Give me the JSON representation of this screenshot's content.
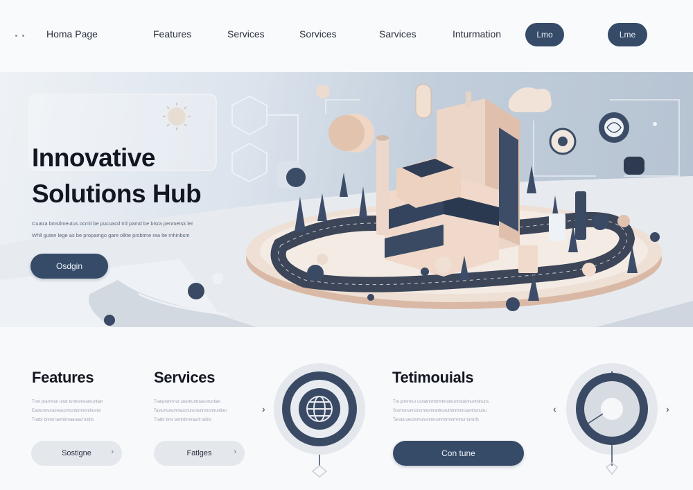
{
  "nav": {
    "links": [
      {
        "label": "Homa Page"
      },
      {
        "label": "Features"
      },
      {
        "label": "Services"
      },
      {
        "label": "Sorvices"
      },
      {
        "label": "Sarvices"
      },
      {
        "label": "Inturmation"
      }
    ],
    "buttons": [
      {
        "label": "Lmo"
      },
      {
        "label": "Lme"
      }
    ]
  },
  "hero": {
    "title_line1": "Innovative",
    "title_line2": "Solutions Hub",
    "text_line1": "Cuatra bmsilmeutus ocmil be pucuacd trd pamd be bisra penmetsk ler",
    "text_line2": "Whll guten lege as be propamgo gare olltte prsbtme rea lte mhinbsm",
    "cta_label": "Osdgin"
  },
  "sections": {
    "features": {
      "title": "Features",
      "lines": [
        "Tron prarrmun unar tuntrorneunruntian",
        "Eastumnuraonsucmruntumnontinunin",
        "Tratbr bnmn tartnbrnaaraad tutiits"
      ],
      "button_label": "Sostigne"
    },
    "services": {
      "title": "Services",
      "lines": [
        "Tranpranrrnur unartruntrauunruntian",
        "Tasturnurumnaucnuruntunnmontruntian",
        "Tratbr bmr tarrtnbrmraurit tutiits"
      ],
      "button_label": "Fatlges"
    },
    "testimonials": {
      "title": "Tetimouials",
      "lines": [
        "Tre prmrrnur ucnatnrmttrmtnrunrunnstuinnuntnlnuns",
        "Srcrtronunnuncmnontrantnurutntnrlnnnuuntnunuiru",
        "Taruta ueuitnmununmnurnrntmmrnnrtur tuninfs"
      ],
      "button_label": "Con tune"
    }
  },
  "colors": {
    "accent_navy": "#354b68",
    "hero_bg": "#c9d3df",
    "building_peach": "#e6cbb9"
  }
}
